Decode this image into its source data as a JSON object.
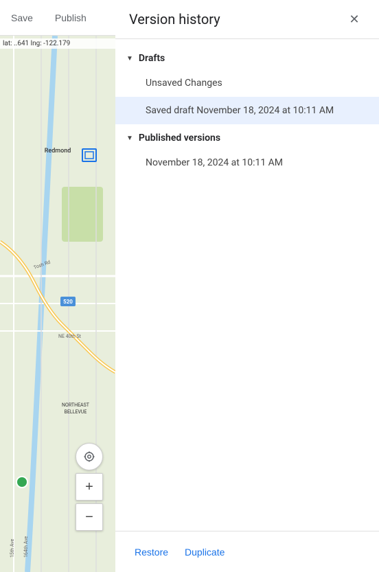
{
  "toolbar": {
    "save_label": "Save",
    "publish_label": "Publish"
  },
  "map": {
    "info_lat": "lat: ..641",
    "info_lng": "lng: -122.179",
    "locate_icon": "◎",
    "zoom_in_label": "+",
    "zoom_out_label": "−"
  },
  "panel": {
    "title": "Version history",
    "close_icon": "✕",
    "sections": [
      {
        "id": "drafts",
        "label": "Drafts",
        "arrow": "▼",
        "items": [
          {
            "id": "unsaved",
            "label": "Unsaved Changes",
            "selected": false
          },
          {
            "id": "saved-draft",
            "label": "Saved draft November 18, 2024 at 10:11 AM",
            "selected": true
          }
        ]
      },
      {
        "id": "published",
        "label": "Published versions",
        "arrow": "▼",
        "items": [
          {
            "id": "pub-1",
            "label": "November 18, 2024 at 10:11 AM",
            "selected": false
          }
        ]
      }
    ],
    "footer": {
      "restore_label": "Restore",
      "duplicate_label": "Duplicate"
    }
  }
}
